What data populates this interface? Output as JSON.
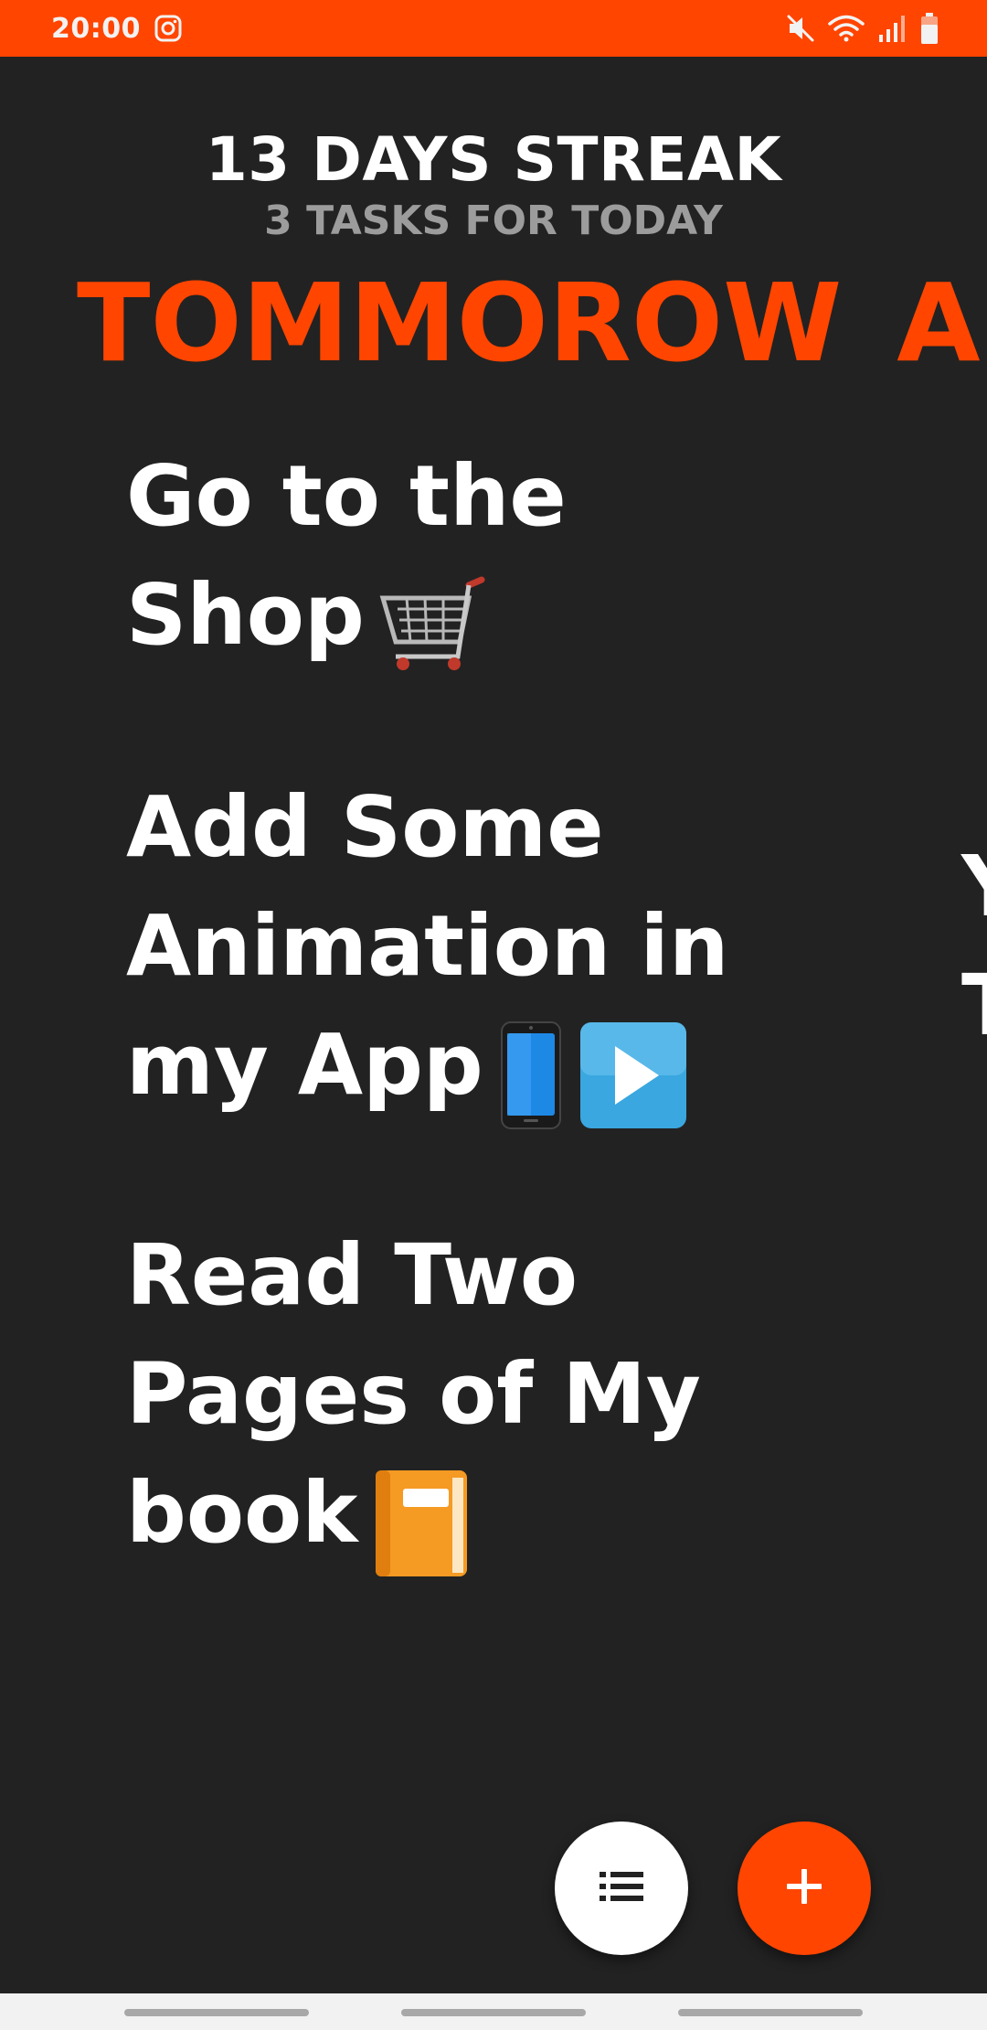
{
  "colors": {
    "accent": "#FF4500",
    "background": "#222222",
    "text": "#FFFFFF",
    "muted_text": "#9C9C9C",
    "fab_secondary": "#FFFFFF"
  },
  "status_bar": {
    "time": "20:00",
    "left_icons": [
      "instagram-icon"
    ],
    "right_icons": [
      "mute-icon",
      "wifi-icon",
      "signal-icon",
      "battery-icon"
    ]
  },
  "header": {
    "streak": "13 DAYS STREAK",
    "tasks_count": "3 TASKS FOR TODAY"
  },
  "day_tabs": [
    {
      "label": "TOMMOROW"
    },
    {
      "label": "A"
    }
  ],
  "tasks": [
    {
      "text": "Go to the Shop",
      "emoji_icons": [
        "shopping-cart-icon"
      ]
    },
    {
      "text": "Add Some Animation in my App",
      "emoji_icons": [
        "mobile-phone-icon",
        "play-button-icon"
      ]
    },
    {
      "text": "Read Two Pages of My book",
      "emoji_icons": [
        "book-icon"
      ]
    }
  ],
  "peek_card": {
    "line1": "Y",
    "line2": "T"
  },
  "fabs": {
    "list_icon": "list-icon",
    "add_icon": "plus-icon"
  }
}
